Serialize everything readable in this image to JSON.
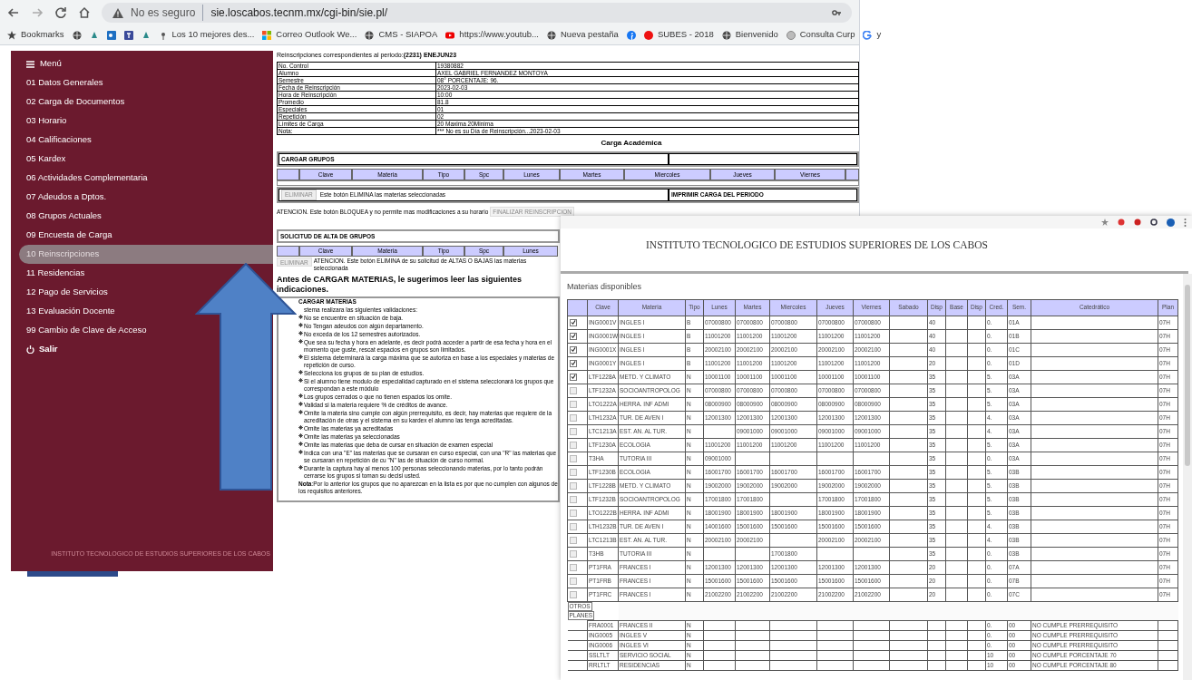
{
  "browser": {
    "security": "No es seguro",
    "url": "sie.loscabos.tecnm.mx/cgi-bin/sie.pl/",
    "bookmarks": [
      {
        "kind": "star",
        "label": "Bookmarks"
      },
      {
        "kind": "globe"
      },
      {
        "kind": "app"
      },
      {
        "kind": "outlook"
      },
      {
        "kind": "teams"
      },
      {
        "kind": "app"
      },
      {
        "kind": "pin",
        "label": "Los 10 mejores des..."
      },
      {
        "kind": "windows",
        "label": "Correo Outlook We..."
      },
      {
        "kind": "globe",
        "label": "CMS - SIAPOA"
      },
      {
        "kind": "youtube",
        "label": "https://www.youtub..."
      },
      {
        "kind": "globe",
        "label": "Nueva pestaña"
      },
      {
        "kind": "facebook"
      },
      {
        "kind": "red",
        "label": "SUBES - 2018"
      },
      {
        "kind": "globe",
        "label": "Bienvenido"
      },
      {
        "kind": "seal",
        "label": "Consulta Curp"
      },
      {
        "kind": "google",
        "label": "y"
      }
    ]
  },
  "sidebar": {
    "menu": "Menú",
    "items": [
      {
        "label": "01 Datos Generales",
        "selected": false
      },
      {
        "label": "02 Carga de Documentos",
        "selected": false
      },
      {
        "label": "03 Horario",
        "selected": false
      },
      {
        "label": "04 Calificaciones",
        "selected": false
      },
      {
        "label": "05 Kardex",
        "selected": false
      },
      {
        "label": "06 Actividades Complementaria",
        "selected": false
      },
      {
        "label": "07 Adeudos a Dptos.",
        "selected": false
      },
      {
        "label": "08 Grupos Actuales",
        "selected": false
      },
      {
        "label": "09 Encuesta de Carga",
        "selected": false
      },
      {
        "label": "10 Reinscripciones",
        "selected": true
      },
      {
        "label": "11 Residencias",
        "selected": false
      },
      {
        "label": "12 Pago de Servicios",
        "selected": false
      },
      {
        "label": "13 Evaluación Docente",
        "selected": false
      },
      {
        "label": "99 Cambio de Clave de Acceso",
        "selected": false
      }
    ],
    "logout": "Salir",
    "footer": "INSTITUTO TECNOLOGICO DE ESTUDIOS SUPERIORES DE LOS CABOS"
  },
  "main": {
    "period": "Reinscripciones correspondientes al periodo:**(2231) ENEJUN23**",
    "info": [
      [
        "No. Control",
        "19380882"
      ],
      [
        "Alumno",
        "AXEL GABRIEL FERNANDEZ MONTOYA"
      ],
      [
        "Semestre",
        "08° PORCENTAJE: 96."
      ],
      [
        "Fecha de Reinscripción",
        "2023-02-03"
      ],
      [
        "Hora de Reinscripción",
        "10:00"
      ],
      [
        "Promedio",
        "81.8"
      ],
      [
        "Especiales",
        "01"
      ],
      [
        "Repetición",
        "02"
      ],
      [
        "Límites de Carga",
        "20 Maxima 20Minima"
      ],
      [
        "Nota:",
        "*** No es su Día de Reinscripción...2023-02-03"
      ]
    ],
    "carga_title": "Carga Académica",
    "cargar_grupos": "CARGAR GRUPOS",
    "carga_columns": [
      "",
      "Clave",
      "Materia",
      "Tipo",
      "Spc",
      "Lunes",
      "Martes",
      "Miercoles",
      "Jueves",
      "Viernes",
      ""
    ],
    "eliminar_button": "ELIMINAR",
    "eliminar_note": "Este botón ELIMINA las materias seleccionadas",
    "imprimir": "IMPRIMIR CARGA DEL PERIODO",
    "atencion": "ATENCION. Este botón BLOQUEA y no permite mas modificaciones a su horario",
    "finalizar_button": "FINALIZAR REINSCRIPCION",
    "solicitud": "SOLICITUD DE ALTA DE GRUPOS",
    "solicitud_columns": [
      "",
      "Clave",
      "Materia",
      "Tipo",
      "Spc",
      "Lunes"
    ],
    "solicitud_button": "ELIMINAR",
    "solicitud_note": "ATENCION. Este botón ELIMINA de su solicitud de ALTAS O BAJAS las materias seleccionada",
    "heading": "Antes de CARGAR MATERIAS, le sugerimos leer las siguientes indicaciones.",
    "instructions_title": "CARGAR MATERIAS",
    "instructions_intro": "stema realizara las siguientes validaciones:",
    "instructions": [
      "No se encuentre en situación de baja.",
      "No Tengan adeudos con algún departamento.",
      "No exceda de los 12 semestres autorizados.",
      "Que sea su fecha y hora en adelante, es decir podrá acceder a partir de esa fecha y hora en el momento que guste, rescat espacios en grupos son limitados.",
      "El sistema determinará la carga máxima que se autoriza en base a los especiales y materias de repetición de curso.",
      "Selecciona los grupos de su plan de estudios.",
      "Si el alumno tiene modulo de especialidad capturado en el sistema seleccionará los grupos que correspondan a este módulo",
      "Los grupos cerrados o que no tienen espacios los omite.",
      "Validad si la materia requiere % de créditos de avance.",
      "Omite la materia sino cumple con algún prerrequisito, es decir, hay materias que requiere de la acreditación de otras y el sistema en su kardex el alumno las tenga acreditadas.",
      "Omite las materias ya acreditadas",
      "Omite las materias ya seleccionadas",
      "Omite las materias que deba de cursar en situación de examen especial",
      "Indica con una \"E\" las materias que se cursaran en curso especial, con una \"R\" las materias que se cursaran en repetición de cu \"N\" las de situación de curso normal.",
      "Durante la captura hay al menos 100 personas seleccionando materias, por lo tanto podrán cerrarse los grupos si toman su decisi usted."
    ],
    "instructions_note": "**Nota**:Por lo anterior los grupos que no aparezcan en la lista es por que no cumplen con algunos de los requisitos anteriores."
  },
  "popup": {
    "title": "INSTITUTO TECNOLOGICO DE ESTUDIOS SUPERIORES DE LOS CABOS",
    "section": "Materias disponibles",
    "columns": [
      "",
      "Clave",
      "Materia",
      "Tipo",
      "Lunes",
      "Martes",
      "Miercoles",
      "Jueves",
      "Viernes",
      "Sabado",
      "Disp",
      "Base",
      "Disp",
      "Cred.",
      "Sem.",
      "Catedrático",
      "Plan"
    ],
    "rows": [
      {
        "kind": "group",
        "checked": true,
        "cells": [
          "ING0001V",
          "INGLES I",
          "B",
          "07000800",
          "07000800",
          "07000800",
          "07000800",
          "07000800",
          "",
          "40",
          "",
          "",
          "0.",
          "01A",
          "",
          "07H"
        ]
      },
      {
        "kind": "group",
        "checked": true,
        "cells": [
          "ING0001W",
          "INGLES I",
          "B",
          "11001200",
          "11001200",
          "11001200",
          "11001200",
          "11001200",
          "",
          "40",
          "",
          "",
          "0.",
          "01B",
          "",
          "07H"
        ]
      },
      {
        "kind": "group",
        "checked": true,
        "cells": [
          "ING0001X",
          "INGLES I",
          "B",
          "20002100",
          "20002100",
          "20002100",
          "20002100",
          "20002100",
          "",
          "40",
          "",
          "",
          "0.",
          "01C",
          "",
          "07H"
        ]
      },
      {
        "kind": "group",
        "checked": true,
        "cells": [
          "ING0001Y",
          "INGLES I",
          "B",
          "11001200",
          "11001200",
          "11001200",
          "11001200",
          "11001200",
          "",
          "20",
          "",
          "",
          "0.",
          "01D",
          "",
          "07H"
        ]
      },
      {
        "kind": "group",
        "checked": true,
        "cells": [
          "LTF1228A",
          "METD. Y CLIMATO",
          "N",
          "10001100",
          "10001100",
          "10001100",
          "10001100",
          "10001100",
          "",
          "35",
          "",
          "",
          "5.",
          "03A",
          "",
          "07H"
        ]
      },
      {
        "kind": "group",
        "checked": false,
        "cells": [
          "LTF1232A",
          "SOCIOANTROPOLOG",
          "N",
          "07000800",
          "07000800",
          "07000800",
          "07000800",
          "07000800",
          "",
          "35",
          "",
          "",
          "5.",
          "03A",
          "",
          "07H"
        ]
      },
      {
        "kind": "group",
        "checked": false,
        "cells": [
          "LTO1222A",
          "HERRA. INF ADMI",
          "N",
          "08000900",
          "08000900",
          "08000900",
          "08000900",
          "08000900",
          "",
          "35",
          "",
          "",
          "5.",
          "03A",
          "",
          "07H"
        ]
      },
      {
        "kind": "group",
        "checked": false,
        "cells": [
          "LTH1232A",
          "TUR. DE AVEN I",
          "N",
          "12001300",
          "12001300",
          "12001300",
          "12001300",
          "12001300",
          "",
          "35",
          "",
          "",
          "4.",
          "03A",
          "",
          "07H"
        ]
      },
      {
        "kind": "group",
        "checked": false,
        "cells": [
          "LTC1213A",
          "EST. AN. AL TUR.",
          "N",
          "",
          "09001000",
          "09001000",
          "09001000",
          "09001000",
          "",
          "35",
          "",
          "",
          "4.",
          "03A",
          "",
          "07H"
        ]
      },
      {
        "kind": "group",
        "checked": false,
        "cells": [
          "LTF1230A",
          "ECOLOGIA",
          "N",
          "11001200",
          "11001200",
          "11001200",
          "11001200",
          "11001200",
          "",
          "35",
          "",
          "",
          "5.",
          "03A",
          "",
          "07H"
        ]
      },
      {
        "kind": "group",
        "checked": false,
        "cells": [
          "T3HA",
          "TUTORIA III",
          "N",
          "09001000",
          "",
          "",
          "",
          "",
          "",
          "35",
          "",
          "",
          "0.",
          "03A",
          "",
          "07H"
        ]
      },
      {
        "kind": "group",
        "checked": false,
        "cells": [
          "LTF1230B",
          "ECOLOGIA",
          "N",
          "16001700",
          "16001700",
          "16001700",
          "16001700",
          "16001700",
          "",
          "35",
          "",
          "",
          "5.",
          "03B",
          "",
          "07H"
        ]
      },
      {
        "kind": "group",
        "checked": false,
        "cells": [
          "LTF1228B",
          "METD. Y CLIMATO",
          "N",
          "19002000",
          "19002000",
          "19002000",
          "19002000",
          "19002000",
          "",
          "35",
          "",
          "",
          "5.",
          "03B",
          "",
          "07H"
        ]
      },
      {
        "kind": "group",
        "checked": false,
        "cells": [
          "LTF1232B",
          "SOCIOANTROPOLOG",
          "N",
          "17001800",
          "17001800",
          "",
          "17001800",
          "17001800",
          "",
          "35",
          "",
          "",
          "5.",
          "03B",
          "",
          "07H"
        ]
      },
      {
        "kind": "group",
        "checked": false,
        "cells": [
          "LTO1222B",
          "HERRA. INF ADMI",
          "N",
          "18001900",
          "18001900",
          "18001900",
          "18001900",
          "18001900",
          "",
          "35",
          "",
          "",
          "5.",
          "03B",
          "",
          "07H"
        ]
      },
      {
        "kind": "group",
        "checked": false,
        "cells": [
          "LTH1232B",
          "TUR. DE AVEN I",
          "N",
          "14001600",
          "15001600",
          "15001600",
          "15001600",
          "15001600",
          "",
          "35",
          "",
          "",
          "4.",
          "03B",
          "",
          "07H"
        ]
      },
      {
        "kind": "group",
        "checked": false,
        "cells": [
          "LTC1213B",
          "EST. AN. AL TUR.",
          "N",
          "20002100",
          "20002100",
          "",
          "20002100",
          "20002100",
          "",
          "35",
          "",
          "",
          "4.",
          "03B",
          "",
          "07H"
        ]
      },
      {
        "kind": "group",
        "checked": false,
        "cells": [
          "T3HB",
          "TUTORIA III",
          "N",
          "",
          "",
          "17001800",
          "",
          "",
          "",
          "35",
          "",
          "",
          "0.",
          "03B",
          "",
          "07H"
        ]
      },
      {
        "kind": "group",
        "checked": false,
        "cells": [
          "PT1FRA",
          "FRANCES I",
          "N",
          "12001300",
          "12001300",
          "12001300",
          "12001300",
          "12001300",
          "",
          "20",
          "",
          "",
          "0.",
          "07A",
          "",
          "07H"
        ]
      },
      {
        "kind": "group",
        "checked": false,
        "cells": [
          "PT1FRB",
          "FRANCES I",
          "N",
          "15001600",
          "15001600",
          "15001600",
          "15001600",
          "15001600",
          "",
          "20",
          "",
          "",
          "0.",
          "07B",
          "",
          "07H"
        ]
      },
      {
        "kind": "group",
        "checked": false,
        "cells": [
          "PT1FRC",
          "FRANCES I",
          "N",
          "21002200",
          "21002200",
          "21002200",
          "21002200",
          "21002200",
          "",
          "20",
          "",
          "",
          "0.",
          "07C",
          "",
          "07H"
        ]
      },
      {
        "kind": "label",
        "text": "OTROS"
      },
      {
        "kind": "label",
        "text": "PLANES"
      },
      {
        "kind": "other",
        "cells": [
          "FRA0001",
          "FRANCES II",
          "N",
          "",
          "",
          "",
          "",
          "",
          "",
          "",
          "",
          "",
          "0.",
          "00",
          "NO CUMPLE PRERREQUISITO",
          ""
        ]
      },
      {
        "kind": "other",
        "cells": [
          "ING0005",
          "INGLES V",
          "N",
          "",
          "",
          "",
          "",
          "",
          "",
          "",
          "",
          "",
          "0.",
          "00",
          "NO CUMPLE PRERREQUISITO",
          ""
        ]
      },
      {
        "kind": "other",
        "cells": [
          "ING0006",
          "INGLES VI",
          "N",
          "",
          "",
          "",
          "",
          "",
          "",
          "",
          "",
          "",
          "0.",
          "00",
          "NO CUMPLE PRERREQUISITO",
          ""
        ]
      },
      {
        "kind": "other",
        "cells": [
          "SSLTLT",
          "SERVICIO SOCIAL",
          "N",
          "",
          "",
          "",
          "",
          "",
          "",
          "",
          "",
          "",
          "10",
          "00",
          "NO CUMPLE PORCENTAJE 70",
          ""
        ]
      },
      {
        "kind": "other",
        "cells": [
          "RRLTLT",
          "RESIDENCIAS",
          "N",
          "",
          "",
          "",
          "",
          "",
          "",
          "",
          "",
          "",
          "10",
          "00",
          "NO CUMPLE PORCENTAJE 80",
          ""
        ]
      }
    ]
  }
}
